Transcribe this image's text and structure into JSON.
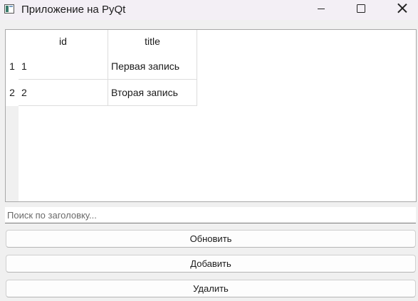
{
  "window": {
    "title": "Приложение на PyQt",
    "icons": {
      "app": "window-app-icon",
      "minimize": "minimize-icon",
      "maximize": "maximize-icon",
      "close": "close-icon"
    }
  },
  "table": {
    "columns": [
      "id",
      "title"
    ],
    "row_headers": [
      "1",
      "2"
    ],
    "rows": [
      [
        "1",
        "Первая запись"
      ],
      [
        "2",
        "Вторая запись"
      ]
    ]
  },
  "search": {
    "placeholder": "Поиск по заголовку...",
    "value": ""
  },
  "buttons": {
    "refresh": "Обновить",
    "add": "Добавить",
    "delete": "Удалить"
  }
}
